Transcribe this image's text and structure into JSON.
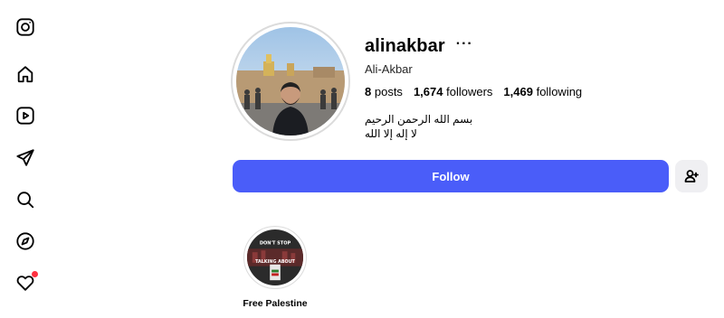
{
  "sidebar": {
    "items": [
      {
        "name": "instagram-icon"
      },
      {
        "name": "home-icon"
      },
      {
        "name": "reels-icon"
      },
      {
        "name": "messages-icon"
      },
      {
        "name": "search-icon"
      },
      {
        "name": "explore-icon"
      },
      {
        "name": "notifications-icon"
      }
    ]
  },
  "profile": {
    "username": "alinakbar",
    "more_label": "···",
    "full_name": "Ali-Akbar",
    "stats": {
      "posts_count": "8",
      "posts_label": "posts",
      "followers_count": "1,674",
      "followers_label": "followers",
      "following_count": "1,469",
      "following_label": "following"
    },
    "bio": {
      "line1": "بسم الله الرحمن الرحيم",
      "line2": "لا إله إلا الله"
    }
  },
  "actions": {
    "follow_label": "Follow"
  },
  "highlights": [
    {
      "label": "Free Palestine",
      "image_text_top": "DON'T STOP",
      "image_text_bottom": "TALKING ABOUT"
    }
  ],
  "colors": {
    "follow_bg": "#4a5df9",
    "suggest_bg": "#efeff2",
    "notification_dot": "#ff3040"
  }
}
